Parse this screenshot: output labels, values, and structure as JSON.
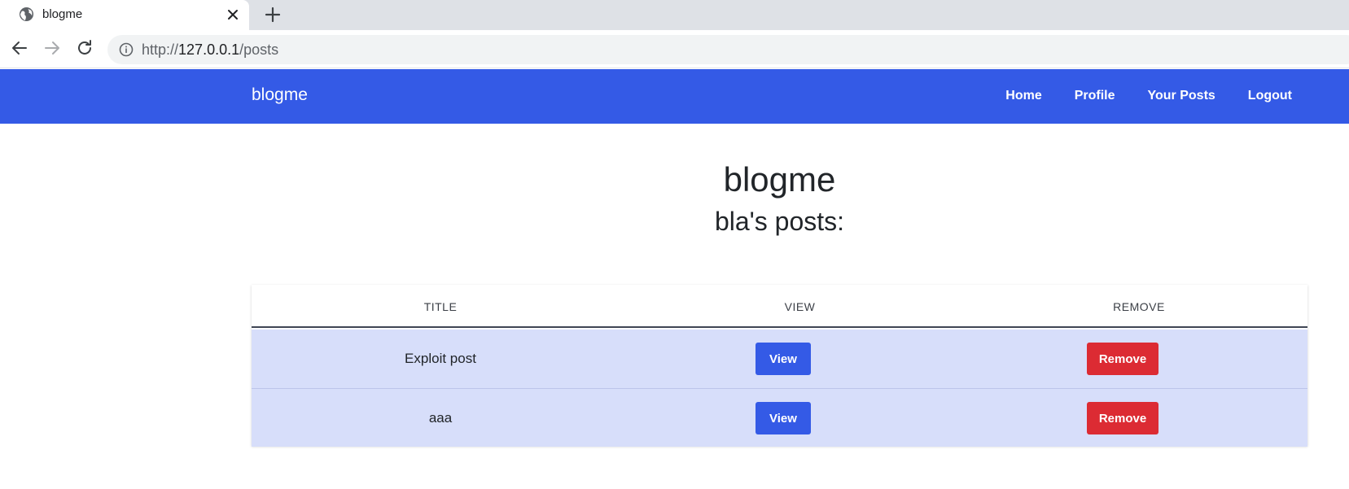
{
  "browser": {
    "tab_title": "blogme",
    "url_prefix": "http://",
    "url_host": "127.0.0.1",
    "url_path": "/posts"
  },
  "navbar": {
    "brand": "blogme",
    "links": [
      "Home",
      "Profile",
      "Your Posts",
      "Logout"
    ]
  },
  "page": {
    "title": "blogme",
    "subtitle": "bla's posts:"
  },
  "table": {
    "headers": [
      "TITLE",
      "VIEW",
      "REMOVE"
    ],
    "rows": [
      {
        "title": "Exploit post",
        "view": "View",
        "remove": "Remove"
      },
      {
        "title": "aaa",
        "view": "View",
        "remove": "Remove"
      }
    ]
  },
  "colors": {
    "primary": "#345ae6",
    "danger": "#dc2b33",
    "row_bg": "#d7defa"
  }
}
